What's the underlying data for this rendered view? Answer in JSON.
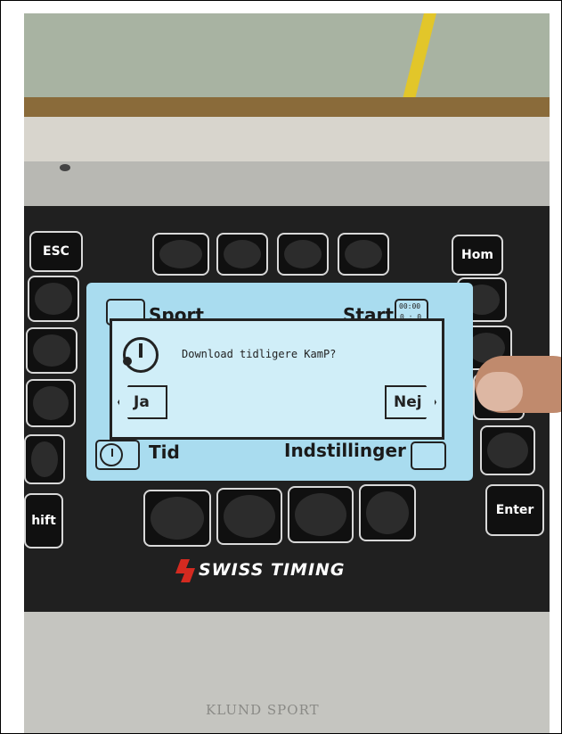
{
  "device": {
    "brand": "SWISS TIMING",
    "footer_text": "KLUND SPORT"
  },
  "keys": {
    "esc": "ESC",
    "home": "Hom",
    "shift": "hift",
    "enter": "Enter"
  },
  "screen": {
    "top_left": "Sport",
    "top_right": "Start",
    "bottom_left": "Tid",
    "bottom_right": "Indstillinger",
    "start_icon_digits": "00:00",
    "start_icon_digits2": "0 : 0"
  },
  "dialog": {
    "message": "Download tidligere KamP?",
    "yes": "Ja",
    "no": "Nej"
  },
  "colors": {
    "screen_bg": "#a9dcef",
    "panel": "#202020",
    "logo_red": "#d42a20"
  }
}
